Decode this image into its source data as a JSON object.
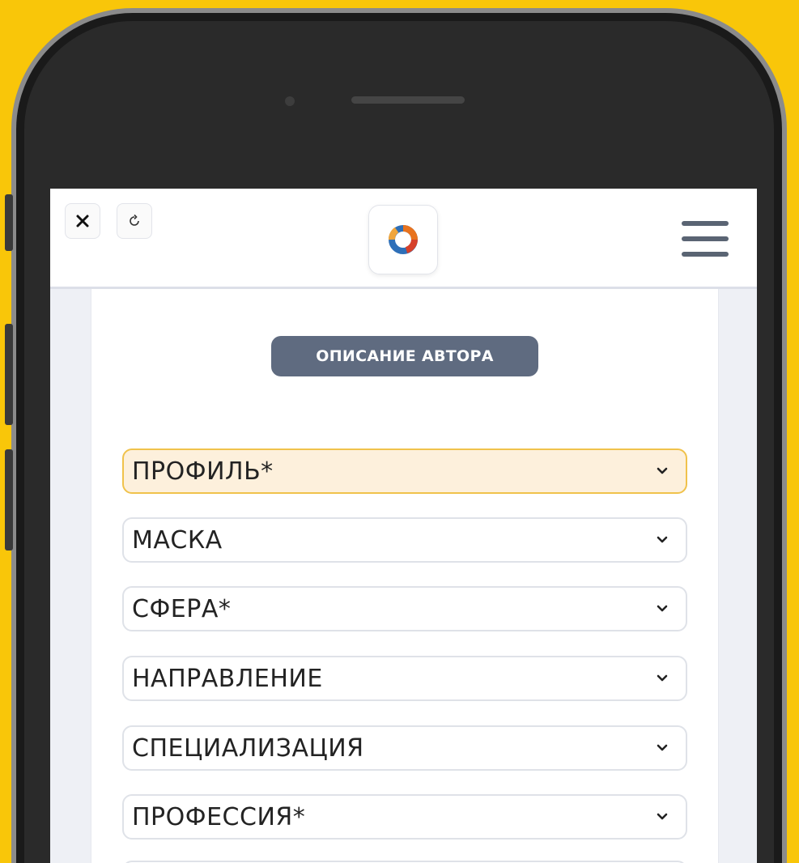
{
  "toolbar": {
    "close_icon": "close-icon",
    "reload_icon": "reload-icon",
    "menu_icon": "hamburger-menu-icon",
    "logo_icon": "app-logo-icon"
  },
  "section": {
    "title": "ОПИСАНИЕ АВТОРА"
  },
  "fields": [
    {
      "label": "ПРОФИЛЬ*",
      "active": true
    },
    {
      "label": "МАСКА",
      "active": false
    },
    {
      "label": "СФЕРА*",
      "active": false
    },
    {
      "label": "НАПРАВЛЕНИЕ",
      "active": false
    },
    {
      "label": "СПЕЦИАЛИЗАЦИЯ",
      "active": false
    },
    {
      "label": "ПРОФЕССИЯ*",
      "active": false
    }
  ],
  "colors": {
    "background": "#f9c609",
    "pill": "#5f6b80",
    "active_field_bg": "#fdf0dc",
    "active_field_border": "#f0c24b"
  }
}
